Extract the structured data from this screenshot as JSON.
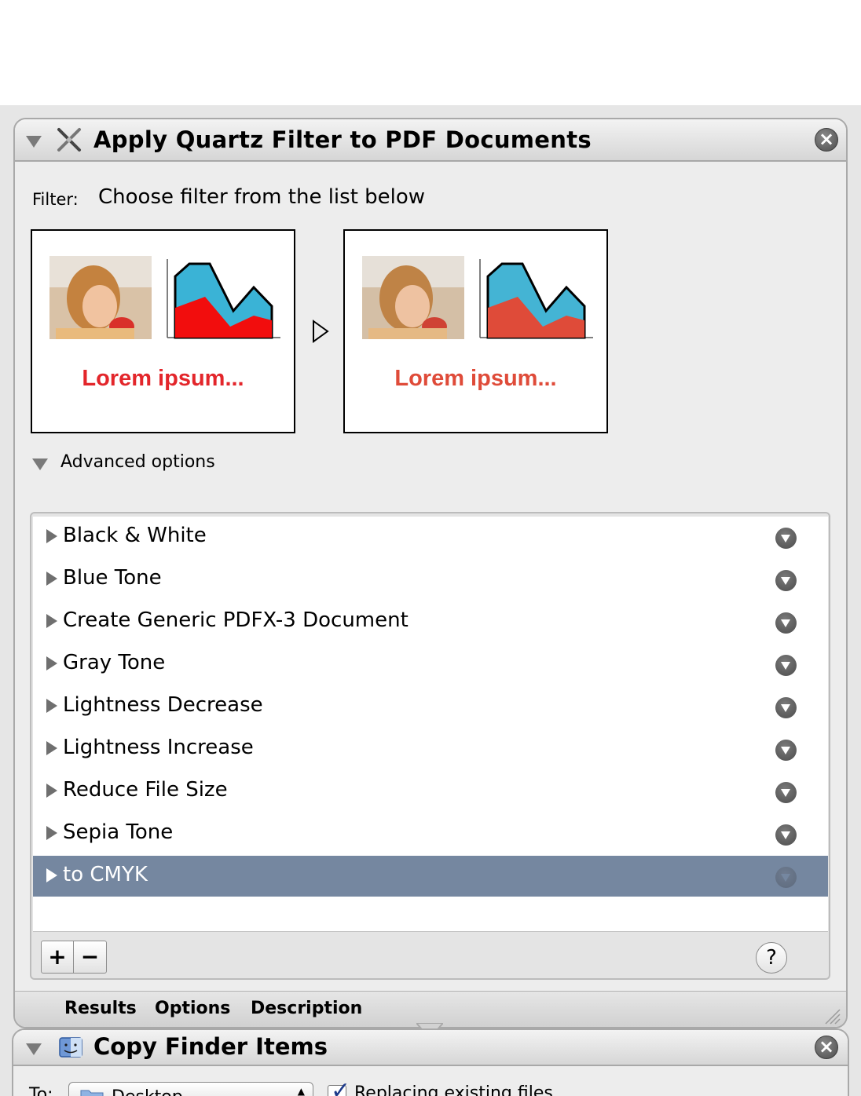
{
  "action": {
    "title": "Apply Quartz Filter to PDF Documents",
    "icon": "x-tool-icon",
    "filter_label": "Filter:",
    "filter_value": "Choose filter from the list below",
    "preview_caption_before": "Lorem ipsum...",
    "preview_caption_after": "Lorem ipsum...",
    "preview_before_caption_color": "#e3262b",
    "preview_after_caption_color": "#df4b39",
    "advanced_options_label": "Advanced options",
    "filters": [
      {
        "label": "Black & White",
        "selected": false
      },
      {
        "label": "Blue Tone",
        "selected": false
      },
      {
        "label": "Create Generic PDFX-3 Document",
        "selected": false
      },
      {
        "label": "Gray Tone",
        "selected": false
      },
      {
        "label": "Lightness Decrease",
        "selected": false
      },
      {
        "label": "Lightness Increase",
        "selected": false
      },
      {
        "label": "Reduce File Size",
        "selected": false
      },
      {
        "label": "Sepia Tone",
        "selected": false
      },
      {
        "label": "to CMYK",
        "selected": true
      }
    ],
    "add_label": "+",
    "remove_label": "−",
    "help_label": "?",
    "tabs": {
      "results": "Results",
      "options": "Options",
      "description": "Description"
    },
    "selection_color": "#7587a0"
  },
  "next_action": {
    "title": "Copy Finder Items",
    "to_label": "To:",
    "destination": "Desktop",
    "replace_label": "Replacing existing files",
    "replace_checked": true
  }
}
